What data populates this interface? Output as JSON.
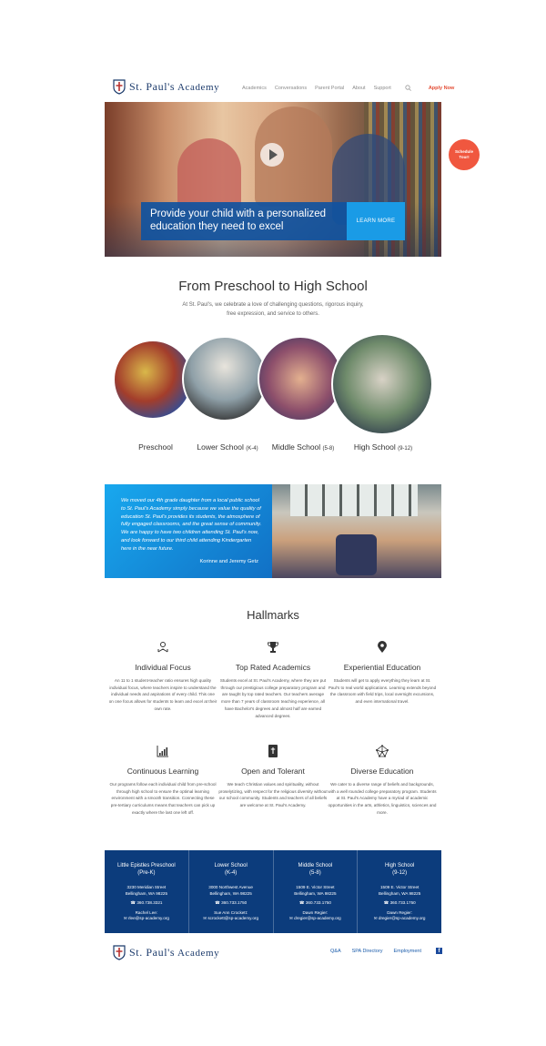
{
  "header": {
    "logo_text_big": "St. Paul's",
    "logo_text_small": "Academy",
    "nav": [
      "Academics",
      "Conversations",
      "Parent Portal",
      "About",
      "Support"
    ],
    "apply_label": "Apply Now"
  },
  "hero": {
    "headline": "Provide your child with a personalized education they need to excel",
    "cta_label": "LEARN MORE",
    "schedule_label_1": "Schedule",
    "schedule_label_2": "Tour!"
  },
  "programs": {
    "title": "From Preschool to High School",
    "description": "At St. Paul's, we celebrate a love of challenging questions, rigorous inquiry, free expression, and service to others.",
    "levels": [
      {
        "name": "Preschool",
        "grades": ""
      },
      {
        "name": "Lower School",
        "grades": "(K-4)"
      },
      {
        "name": "Middle School",
        "grades": "(5-8)"
      },
      {
        "name": "High School",
        "grades": "(9-12)"
      }
    ]
  },
  "testimonial": {
    "quote": "We moved our 4th grade daughter from a local public school to St. Paul's Academy simply because we value the quality of education St. Paul's provides its students, the atmosphere of fully engaged classrooms, and the great sense of community. We are happy to have two children attending St. Paul's now, and look forward to our third child attending Kindergarten here in the near future.",
    "author": "Korinne and Jeremy Getz"
  },
  "hallmarks": {
    "title": "Hallmarks",
    "items": [
      {
        "icon": "reading-child-icon",
        "title": "Individual Focus",
        "text": "An 11 to 1 student-teacher ratio ensures high quality individual focus, where teachers inspire to understand the individual needs and aspirations of every child. This one on one focus allows for students to learn and excel at their own rate."
      },
      {
        "icon": "trophy-icon",
        "title": "Top Rated Academics",
        "text": "Students excel at St. Paul's Academy, where they are put through our prestigious college preparatory program and are taught by top rated teachers. Our teachers average more than 7 years of classroom teaching experience, all have Bachelor's degrees and almost half are earned advanced degrees."
      },
      {
        "icon": "map-pin-icon",
        "title": "Experiential Education",
        "text": "Students will get to apply everything they learn at St. Paul's to real world applications. Learning extends beyond the classroom with field trips, local overnight excursions, and even international travel."
      },
      {
        "icon": "growth-chart-icon",
        "title": "Continuous Learning",
        "text": "Our programs follow each individual child from pre-school through high school to ensure the optimal learning environment with a smooth transition. Connecting these pre-tertiary curriculums means that teachers can pick up exactly where the last one left off."
      },
      {
        "icon": "bible-icon",
        "title": "Open and Tolerant",
        "text": "We teach Christian values and spirituality, without proselytizing, with respect for the religious diversity without our school community. Students and teachers of all beliefs are welcome at St. Paul's Academy."
      },
      {
        "icon": "network-icon",
        "title": "Diverse Education",
        "text": "We cater to a diverse range of beliefs and backgrounds, with a well rounded college preparatory program. Students at St. Paul's Academy have a myriad of academic opportunities in the arts, athletics, linguistics, sciences and more."
      }
    ]
  },
  "contacts": [
    {
      "title1": "Little Epistles Preschool",
      "title2": "(Pre-K)",
      "addr1": "3230 Meridian Street",
      "addr2": "Bellingham, WA 98225",
      "phone": "360.738.3321",
      "contact": "Rachel Lee:",
      "email": "rlee@sp-academy.org"
    },
    {
      "title1": "Lower School",
      "title2": "(K-4)",
      "addr1": "3000 Northwest Avenue",
      "addr2": "Bellingham, WA 98225",
      "phone": "360.733.1750",
      "contact": "Sue Ann Crockett:",
      "email": "scrockett@sp-academy.org"
    },
    {
      "title1": "Middle School",
      "title2": "(5-8)",
      "addr1": "1509 E. Victor Street",
      "addr2": "Bellingham, WA 98225",
      "phone": "360.733.1750",
      "contact": "Dawn Regier:",
      "email": "dregier@sp-academy.org"
    },
    {
      "title1": "High School",
      "title2": "(9-12)",
      "addr1": "1509 E. Victor Street",
      "addr2": "Bellingham, WA 98225",
      "phone": "360.733.1750",
      "contact": "Dawn Regier:",
      "email": "dregier@sp-academy.org"
    }
  ],
  "footer": {
    "links": [
      "Q&A",
      "SPA Directory",
      "Employment"
    ],
    "facebook": "f"
  },
  "colors": {
    "navy": "#0c3c7c",
    "accent": "#f0573f",
    "blue": "#1a9be6"
  }
}
